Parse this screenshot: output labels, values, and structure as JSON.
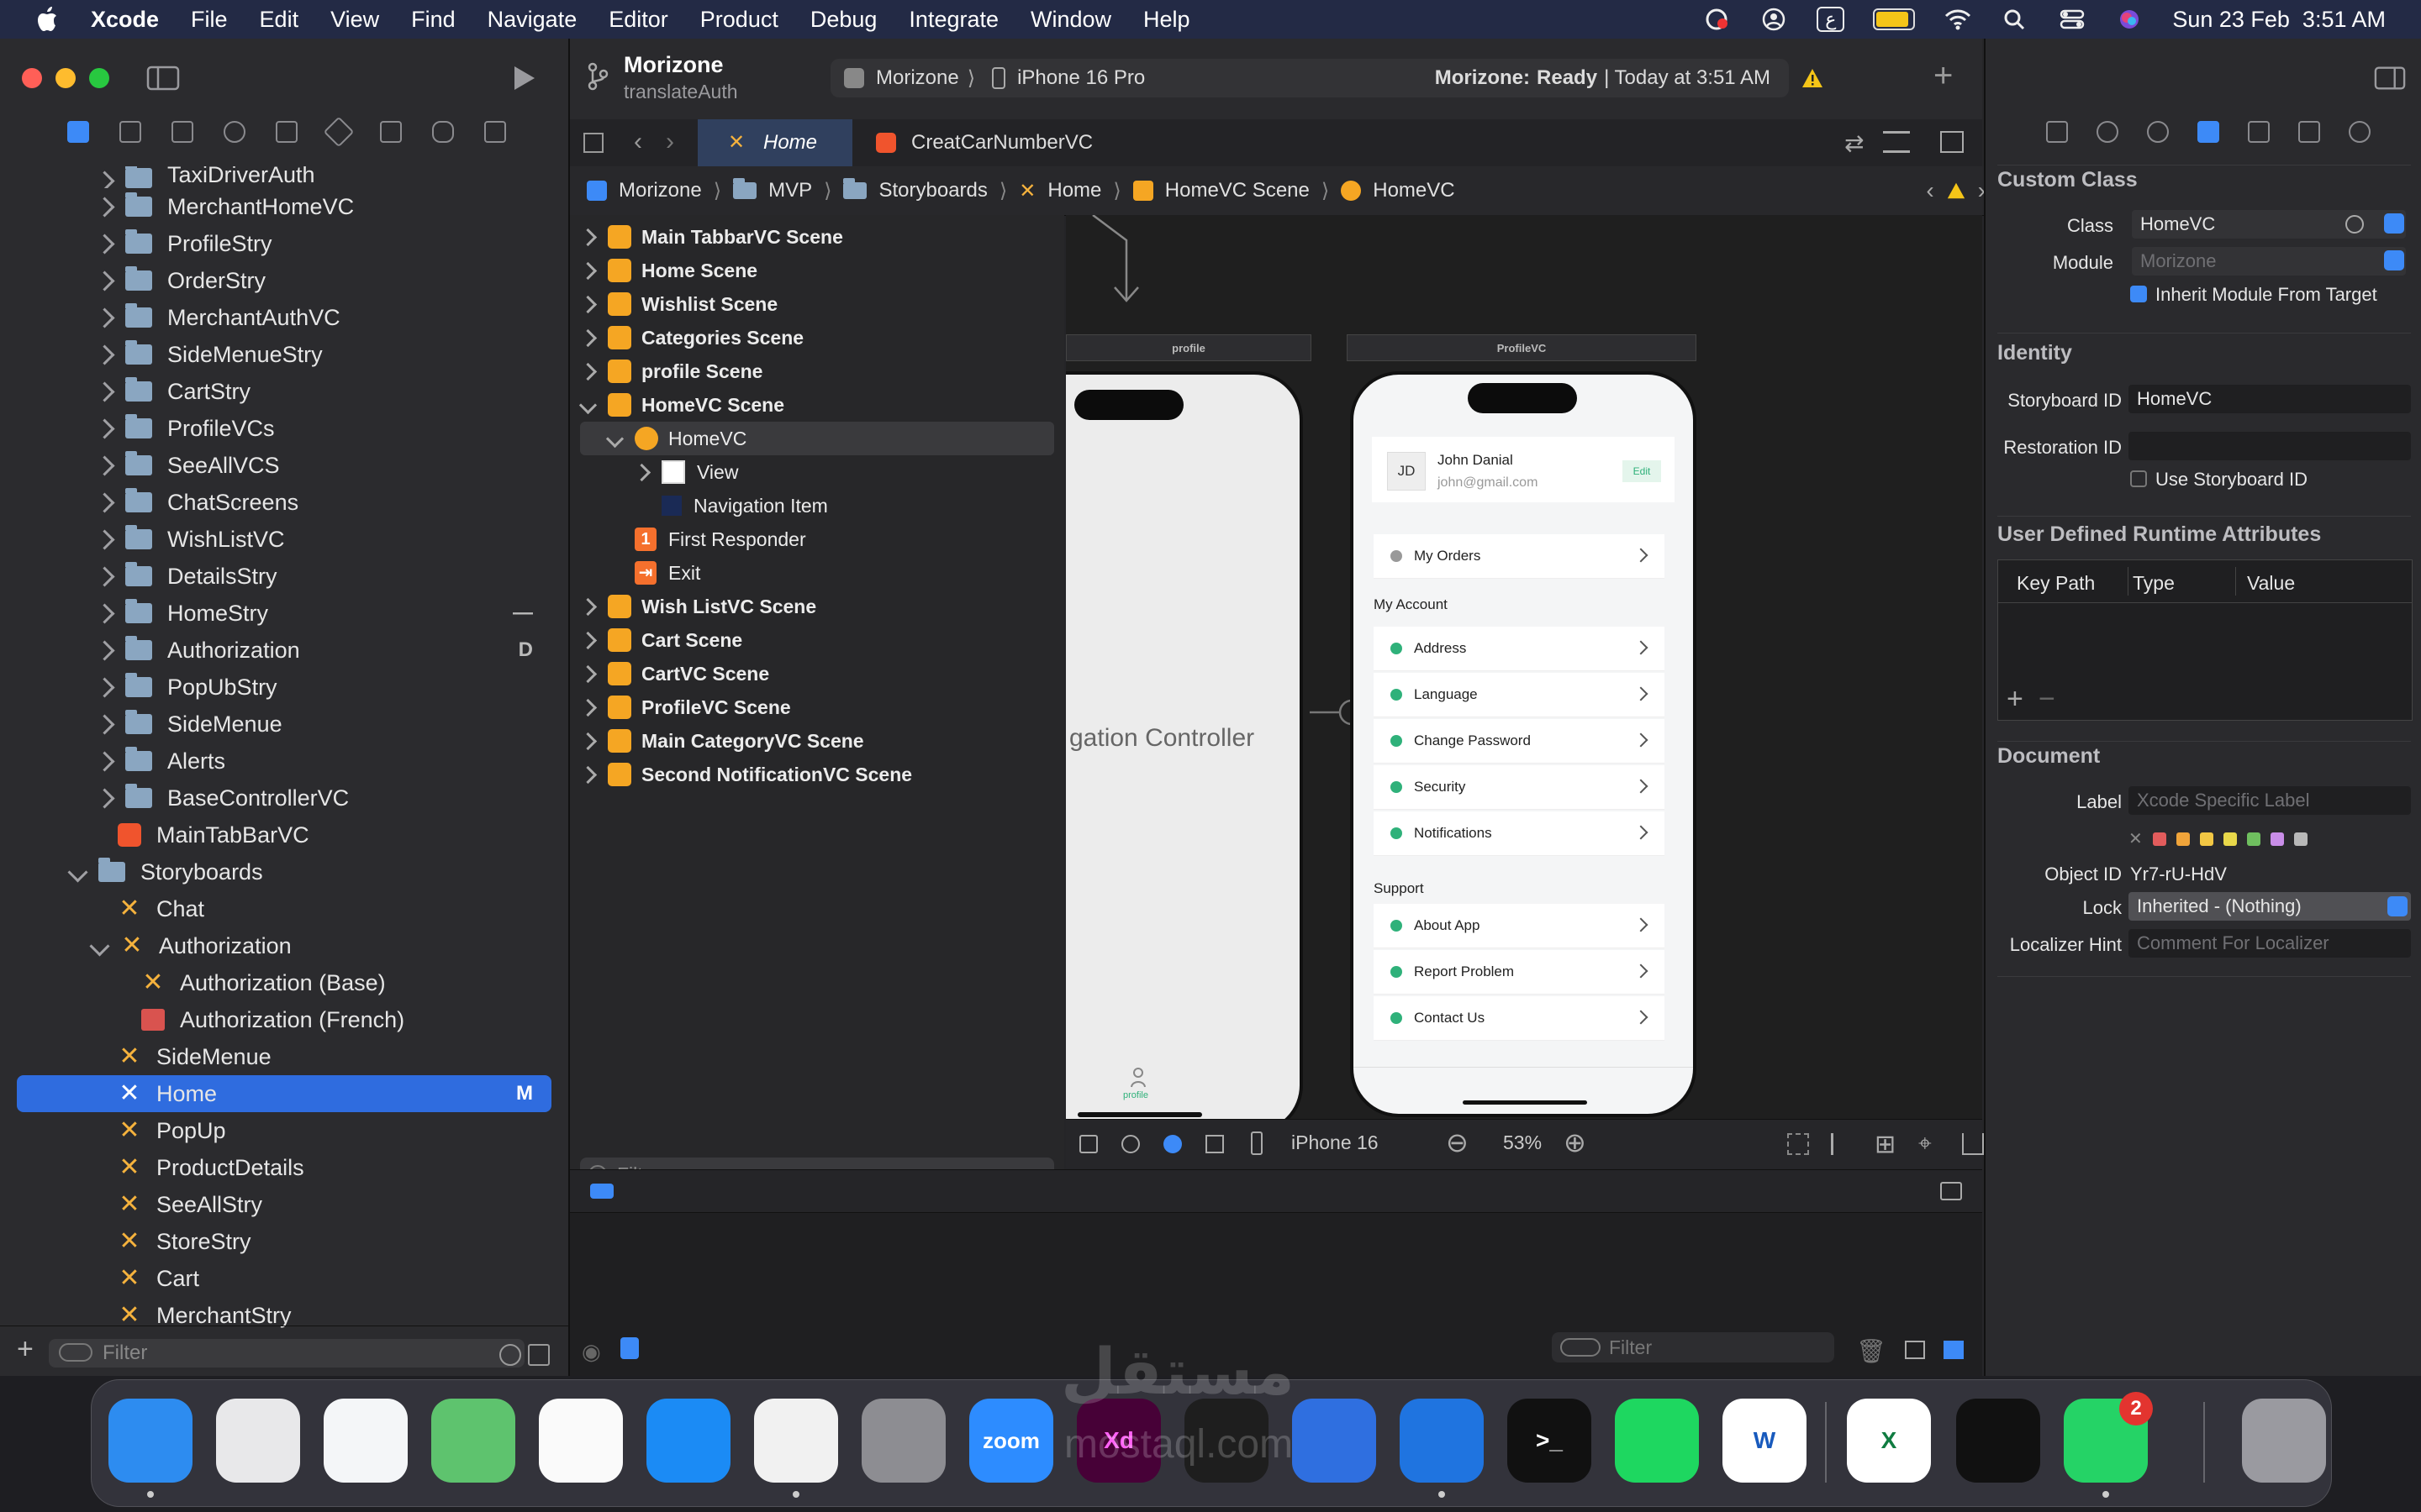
{
  "menubar": {
    "app_name": "Xcode",
    "items": [
      "File",
      "Edit",
      "View",
      "Find",
      "Navigate",
      "Editor",
      "Product",
      "Debug",
      "Integrate",
      "Window",
      "Help"
    ],
    "keyboard_layout": "ع",
    "clock": "Sun 23 Feb  3:51 AM"
  },
  "navigator": {
    "files": [
      {
        "label": "TaxiDriverAuth",
        "kind": "folder"
      },
      {
        "label": "MerchantHomeVC",
        "kind": "folder"
      },
      {
        "label": "ProfileStry",
        "kind": "folder"
      },
      {
        "label": "OrderStry",
        "kind": "folder"
      },
      {
        "label": "MerchantAuthVC",
        "kind": "folder"
      },
      {
        "label": "SideMenueStry",
        "kind": "folder"
      },
      {
        "label": "CartStry",
        "kind": "folder"
      },
      {
        "label": "ProfileVCs",
        "kind": "folder"
      },
      {
        "label": "SeeAllVCS",
        "kind": "folder"
      },
      {
        "label": "ChatScreens",
        "kind": "folder"
      },
      {
        "label": "WishListVC",
        "kind": "folder"
      },
      {
        "label": "DetailsStry",
        "kind": "folder"
      },
      {
        "label": "HomeStry",
        "kind": "folder",
        "badge": "—"
      },
      {
        "label": "Authorization",
        "kind": "folder",
        "badge": "D"
      },
      {
        "label": "PopUbStry",
        "kind": "folder"
      },
      {
        "label": "SideMenue",
        "kind": "folder"
      },
      {
        "label": "Alerts",
        "kind": "folder"
      },
      {
        "label": "BaseControllerVC",
        "kind": "folder"
      },
      {
        "label": "MainTabBarVC",
        "kind": "swift"
      },
      {
        "label": "Storyboards",
        "kind": "group"
      },
      {
        "label": "Chat",
        "kind": "storyboard"
      },
      {
        "label": "Authorization",
        "kind": "storyboard-open"
      },
      {
        "label": "Authorization (Base)",
        "kind": "storyboard-child"
      },
      {
        "label": "Authorization (French)",
        "kind": "strings-child"
      },
      {
        "label": "SideMenue",
        "kind": "storyboard"
      },
      {
        "label": "Home",
        "kind": "storyboard",
        "badge": "M",
        "selected": true
      },
      {
        "label": "PopUp",
        "kind": "storyboard"
      },
      {
        "label": "ProductDetails",
        "kind": "storyboard"
      },
      {
        "label": "SeeAllStry",
        "kind": "storyboard"
      },
      {
        "label": "StoreStry",
        "kind": "storyboard"
      },
      {
        "label": "Cart",
        "kind": "storyboard"
      },
      {
        "label": "MerchantStry",
        "kind": "storyboard"
      }
    ],
    "filter_placeholder": "Filter"
  },
  "titlebar": {
    "project": "Morizone",
    "branch": "translateAuth",
    "scheme": "Morizone",
    "device": "iPhone 16 Pro",
    "status_name": "Morizone:",
    "status_state": "Ready",
    "status_time": "| Today at 3:51 AM"
  },
  "tabs": [
    {
      "label": "Home",
      "active": true
    },
    {
      "label": "CreatCarNumberVC",
      "active": false
    }
  ],
  "jumpbar": [
    "Morizone",
    "MVP",
    "Storyboards",
    "Home",
    "HomeVC Scene",
    "HomeVC"
  ],
  "outline": [
    {
      "label": "Main TabbarVC Scene",
      "level": 0,
      "icon": "scene"
    },
    {
      "label": "Home Scene",
      "level": 0,
      "icon": "scene"
    },
    {
      "label": "Wishlist Scene",
      "level": 0,
      "icon": "scene"
    },
    {
      "label": "Categories Scene",
      "level": 0,
      "icon": "scene"
    },
    {
      "label": "profile Scene",
      "level": 0,
      "icon": "scene"
    },
    {
      "label": "HomeVC Scene",
      "level": 0,
      "icon": "scene",
      "open": true
    },
    {
      "label": "HomeVC",
      "level": 1,
      "icon": "vc",
      "open": true,
      "selected": true
    },
    {
      "label": "View",
      "level": 2,
      "icon": "view"
    },
    {
      "label": "Navigation Item",
      "level": 2,
      "icon": "nav"
    },
    {
      "label": "First Responder",
      "level": 1,
      "icon": "fr"
    },
    {
      "label": "Exit",
      "level": 1,
      "icon": "exit"
    },
    {
      "label": "Wish ListVC Scene",
      "level": 0,
      "icon": "scene"
    },
    {
      "label": "Cart Scene",
      "level": 0,
      "icon": "scene"
    },
    {
      "label": "CartVC Scene",
      "level": 0,
      "icon": "scene"
    },
    {
      "label": "ProfileVC Scene",
      "level": 0,
      "icon": "scene"
    },
    {
      "label": "Main CategoryVC Scene",
      "level": 0,
      "icon": "scene"
    },
    {
      "label": "Second NotificationVC Scene",
      "level": 0,
      "icon": "scene"
    }
  ],
  "outline_filter_placeholder": "Filter",
  "canvas": {
    "left_scene_label": "profile",
    "left_scene_text": "gation Controller",
    "left_tab_label": "profile",
    "right_scene_label": "ProfileVC",
    "avatar_initials": "JD",
    "user_name": "John Danial",
    "user_email": "john@gmail.com",
    "edit_label": "Edit",
    "my_orders": "My Orders",
    "section_account": "My Account",
    "account_rows": [
      "Address",
      "Language",
      "Change Password",
      "Security",
      "Notifications"
    ],
    "section_support": "Support",
    "support_rows": [
      "About App",
      "Report Problem",
      "Contact Us"
    ]
  },
  "canvas_toolbar": {
    "device": "iPhone 16",
    "zoom": "53%"
  },
  "console_filter_placeholder": "Filter",
  "inspector": {
    "custom_class_head": "Custom Class",
    "class_label": "Class",
    "class_value": "HomeVC",
    "module_label": "Module",
    "module_value": "Morizone",
    "inherit_label": "Inherit Module From Target",
    "identity_head": "Identity",
    "storyboard_id_label": "Storyboard ID",
    "storyboard_id_value": "HomeVC",
    "restoration_id_label": "Restoration ID",
    "use_storyboard_id_label": "Use Storyboard ID",
    "runtime_head": "User Defined Runtime Attributes",
    "col_key": "Key Path",
    "col_type": "Type",
    "col_value": "Value",
    "document_head": "Document",
    "label_label": "Label",
    "label_placeholder": "Xcode Specific Label",
    "object_id_label": "Object ID",
    "object_id_value": "Yr7-rU-HdV",
    "lock_label": "Lock",
    "lock_value": "Inherited - (Nothing)",
    "localizer_label": "Localizer Hint",
    "localizer_placeholder": "Comment For Localizer",
    "label_colors": [
      "#e25c5c",
      "#f0a43a",
      "#f2c744",
      "#e8d84a",
      "#6fbf5f",
      "#c98ee8",
      "#b8b8b8"
    ]
  },
  "dock": {
    "apps": [
      {
        "name": "Finder",
        "color": "#2d8cf0"
      },
      {
        "name": "Launchpad",
        "color": "#e8e8ea"
      },
      {
        "name": "Safari",
        "color": "#f4f6f8"
      },
      {
        "name": "Maps",
        "color": "#5ec36e"
      },
      {
        "name": "Photos",
        "color": "#fafafa"
      },
      {
        "name": "App Store",
        "color": "#1b8bf5"
      },
      {
        "name": "Chrome",
        "color": "#f1f1f1"
      },
      {
        "name": "System Settings",
        "color": "#8d8d92"
      },
      {
        "name": "zoom",
        "color": "#2d8cff",
        "text": "zoom"
      },
      {
        "name": "Adobe XD",
        "color": "#470137",
        "text": "Xd"
      },
      {
        "name": "Figma",
        "color": "#1e1e1e"
      },
      {
        "name": "Simulator",
        "color": "#2f6fe0"
      },
      {
        "name": "Xcode",
        "color": "#1f74e0"
      },
      {
        "name": "Terminal",
        "color": "#111111",
        "text": ">_"
      },
      {
        "name": "Spotify",
        "color": "#1ed760"
      },
      {
        "name": "Word",
        "color": "#ffffff",
        "text": "W"
      },
      {
        "name": "Excel",
        "color": "#ffffff",
        "text": "X"
      },
      {
        "name": "Ghost",
        "color": "#111111"
      },
      {
        "name": "WhatsApp",
        "color": "#25d366",
        "badge": "2"
      },
      {
        "name": "Trash",
        "color": "#9a9aa0"
      }
    ],
    "watermark": "مستقل",
    "watermark_url": "mostaql.com"
  }
}
